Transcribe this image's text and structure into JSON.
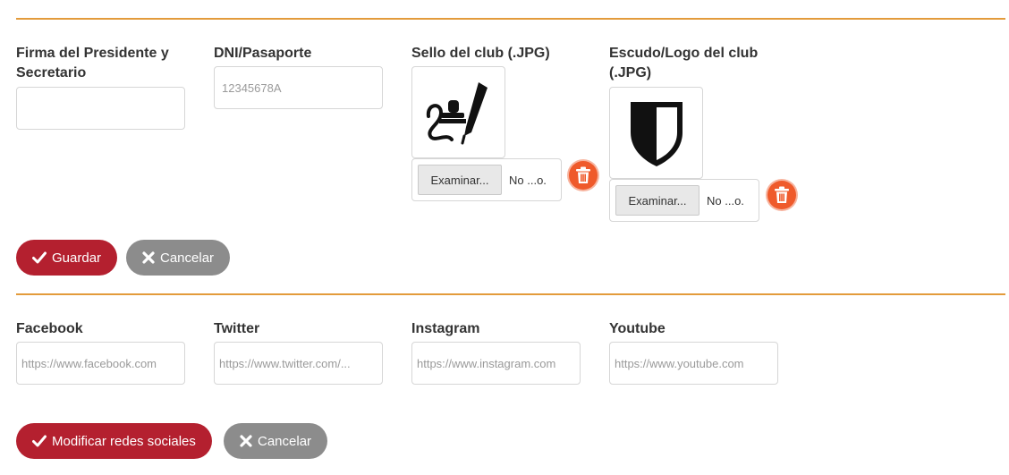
{
  "club_form": {
    "signature_label": "Firma del Presidente y Secretario",
    "signature_value": "",
    "dni_label": "DNI/Pasaporte",
    "dni_placeholder": "12345678A",
    "seal_label": "Sello del club (.JPG)",
    "seal_icon": "signature-stamp-icon",
    "seal_browse": "Examinar...",
    "seal_filename": "No ...o.",
    "logo_label": "Escudo/Logo del club (.JPG)",
    "logo_icon": "shield-icon",
    "logo_browse": "Examinar...",
    "logo_filename": "No ...o.",
    "save_label": "Guardar",
    "cancel_label": "Cancelar"
  },
  "social": {
    "facebook_label": "Facebook",
    "facebook_placeholder": "https://www.facebook.com",
    "twitter_label": "Twitter",
    "twitter_placeholder": "https://www.twitter.com/...",
    "instagram_label": "Instagram",
    "instagram_placeholder": "https://www.instagram.com",
    "youtube_label": "Youtube",
    "youtube_placeholder": "https://www.youtube.com",
    "modify_label": "Modificar redes sociales",
    "cancel_label": "Cancelar"
  },
  "colors": {
    "accent_rule": "#e39b3b",
    "primary_button": "#b4202f",
    "secondary_button": "#8c8c8c",
    "delete_button": "#ef5a2b"
  }
}
